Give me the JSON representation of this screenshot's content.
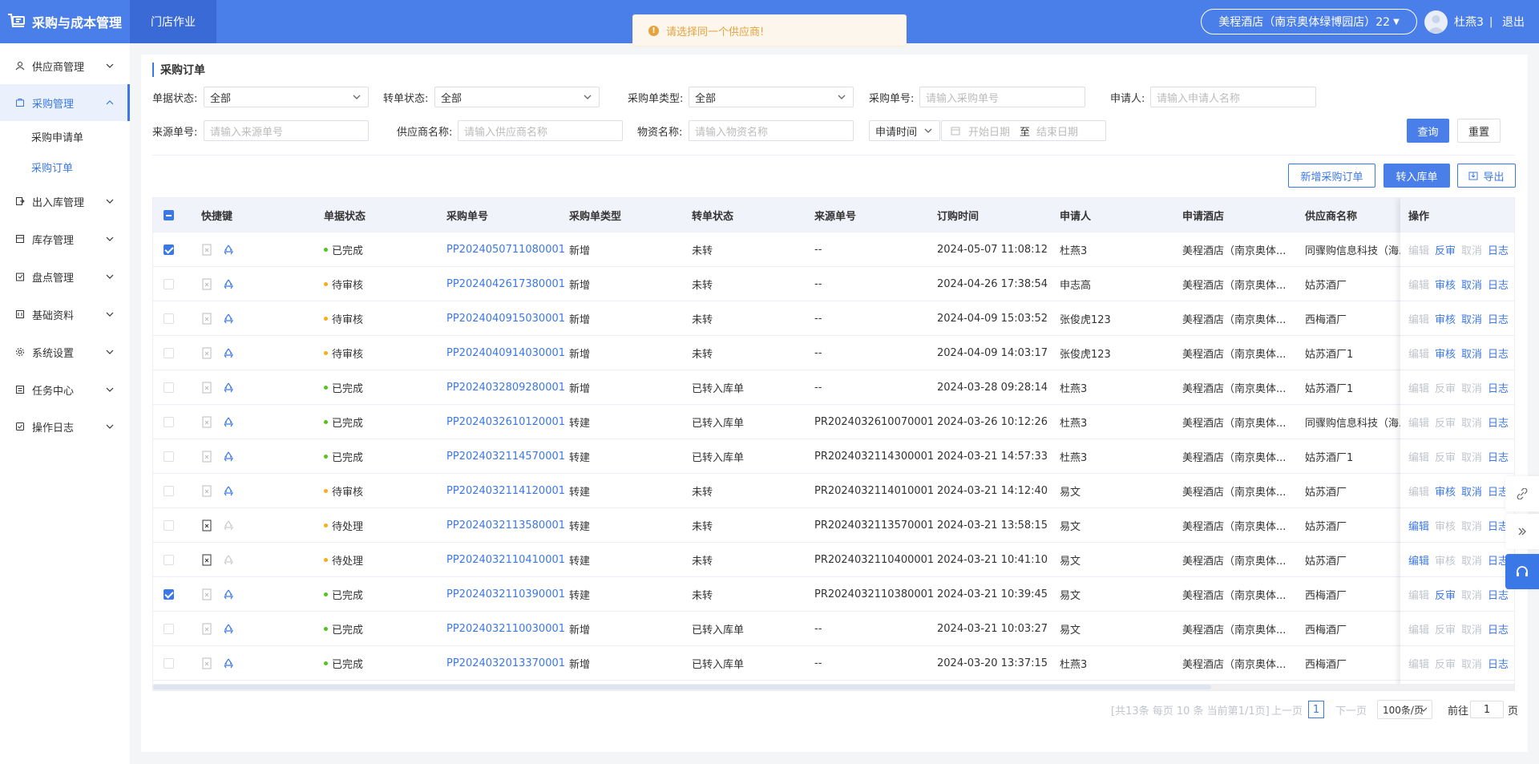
{
  "app": {
    "title": "采购与成本管理",
    "store_tab": "门店作业",
    "hotel": "美程酒店（南京奥体绿博园店）22",
    "user": "杜燕3",
    "separator": "|",
    "logout": "退出"
  },
  "toast": {
    "text": "请选择同一个供应商!"
  },
  "sidebar": {
    "items": [
      {
        "label": "供应商管理",
        "icon": "supplier-icon"
      },
      {
        "label": "采购管理",
        "icon": "purchase-icon",
        "active": true
      },
      {
        "label": "出入库管理",
        "icon": "inout-icon"
      },
      {
        "label": "库存管理",
        "icon": "stock-icon"
      },
      {
        "label": "盘点管理",
        "icon": "inventory-icon"
      },
      {
        "label": "基础资料",
        "icon": "base-data-icon"
      },
      {
        "label": "系统设置",
        "icon": "gear-icon"
      },
      {
        "label": "任务中心",
        "icon": "task-icon"
      },
      {
        "label": "操作日志",
        "icon": "log-icon"
      }
    ],
    "sub_items": [
      {
        "label": "采购申请单"
      },
      {
        "label": "采购订单",
        "current": true
      }
    ]
  },
  "page": {
    "title": "采购订单"
  },
  "filters": {
    "doc_status_label": "单据状态:",
    "doc_status_value": "全部",
    "transfer_status_label": "转单状态:",
    "transfer_status_value": "全部",
    "order_type_label": "采购单类型:",
    "order_type_value": "全部",
    "order_no_label": "采购单号:",
    "order_no_placeholder": "请输入采购单号",
    "applicant_label": "申请人:",
    "applicant_placeholder": "请输入申请人名称",
    "source_no_label": "来源单号:",
    "source_no_placeholder": "请输入来源单号",
    "supplier_label": "供应商名称:",
    "supplier_placeholder": "请输入供应商名称",
    "material_label": "物资名称:",
    "material_placeholder": "请输入物资名称",
    "time_type_value": "申请时间",
    "start_placeholder": "开始日期",
    "date_sep": "至",
    "end_placeholder": "结束日期",
    "query_label": "查询",
    "reset_label": "重置"
  },
  "toolbar": {
    "add_label": "新增采购订单",
    "to_stock_label": "转入库单",
    "export_label": "导出"
  },
  "table": {
    "headers": [
      "快捷键",
      "单据状态",
      "采购单号",
      "采购单类型",
      "转单状态",
      "来源单号",
      "订购时间",
      "申请人",
      "申请酒店",
      "供应商名称",
      "操作"
    ],
    "ops_labels": [
      "编辑",
      "反审",
      "审核",
      "取消",
      "日志"
    ],
    "status_colors": {
      "已完成": "#52c41a",
      "待审核": "#faad14",
      "待处理": "#faad14"
    },
    "rows": [
      {
        "checked": true,
        "status": "已完成",
        "no": "PP2024050711080001",
        "type": "新增",
        "transfer": "未转",
        "source": "--",
        "time": "2024-05-07 11:08:12",
        "applicant": "杜燕3",
        "hotel": "美程酒店（南京奥体...",
        "supplier": "同骤购信息科技（海...",
        "shortcut": "faded",
        "ops": [
          [
            "编辑",
            false
          ],
          [
            "反审",
            true
          ],
          [
            "取消",
            false
          ],
          [
            "日志",
            true
          ]
        ]
      },
      {
        "checked": false,
        "status": "待审核",
        "no": "PP2024042617380001",
        "type": "新增",
        "transfer": "未转",
        "source": "--",
        "time": "2024-04-26 17:38:54",
        "applicant": "申志高",
        "hotel": "美程酒店（南京奥体...",
        "supplier": "姑苏酒厂",
        "shortcut": "faded",
        "ops": [
          [
            "编辑",
            false
          ],
          [
            "审核",
            true
          ],
          [
            "取消",
            true
          ],
          [
            "日志",
            true
          ]
        ]
      },
      {
        "checked": false,
        "status": "待审核",
        "no": "PP2024040915030001",
        "type": "新增",
        "transfer": "未转",
        "source": "--",
        "time": "2024-04-09 15:03:52",
        "applicant": "张俊虎123",
        "hotel": "美程酒店（南京奥体...",
        "supplier": "西梅酒厂",
        "shortcut": "faded",
        "ops": [
          [
            "编辑",
            false
          ],
          [
            "审核",
            true
          ],
          [
            "取消",
            true
          ],
          [
            "日志",
            true
          ]
        ]
      },
      {
        "checked": false,
        "status": "待审核",
        "no": "PP2024040914030001",
        "type": "新增",
        "transfer": "未转",
        "source": "--",
        "time": "2024-04-09 14:03:17",
        "applicant": "张俊虎123",
        "hotel": "美程酒店（南京奥体...",
        "supplier": "姑苏酒厂1",
        "shortcut": "faded",
        "ops": [
          [
            "编辑",
            false
          ],
          [
            "审核",
            true
          ],
          [
            "取消",
            true
          ],
          [
            "日志",
            true
          ]
        ]
      },
      {
        "checked": false,
        "status": "已完成",
        "no": "PP2024032809280001",
        "type": "新增",
        "transfer": "已转入库单",
        "source": "--",
        "time": "2024-03-28 09:28:14",
        "applicant": "杜燕3",
        "hotel": "美程酒店（南京奥体...",
        "supplier": "姑苏酒厂1",
        "shortcut": "faded",
        "ops": [
          [
            "编辑",
            false
          ],
          [
            "反审",
            false
          ],
          [
            "取消",
            false
          ],
          [
            "日志",
            true
          ]
        ]
      },
      {
        "checked": false,
        "status": "已完成",
        "no": "PP2024032610120001",
        "type": "转建",
        "transfer": "已转入库单",
        "source": "PR2024032610070001",
        "time": "2024-03-26 10:12:26",
        "applicant": "杜燕3",
        "hotel": "美程酒店（南京奥体...",
        "supplier": "同骤购信息科技（海...",
        "shortcut": "faded",
        "ops": [
          [
            "编辑",
            false
          ],
          [
            "反审",
            false
          ],
          [
            "取消",
            false
          ],
          [
            "日志",
            true
          ]
        ]
      },
      {
        "checked": false,
        "status": "已完成",
        "no": "PP2024032114570001",
        "type": "转建",
        "transfer": "已转入库单",
        "source": "PR2024032114300001",
        "time": "2024-03-21 14:57:33",
        "applicant": "杜燕3",
        "hotel": "美程酒店（南京奥体...",
        "supplier": "姑苏酒厂1",
        "shortcut": "faded",
        "ops": [
          [
            "编辑",
            false
          ],
          [
            "反审",
            false
          ],
          [
            "取消",
            false
          ],
          [
            "日志",
            true
          ]
        ]
      },
      {
        "checked": false,
        "status": "待审核",
        "no": "PP2024032114120001",
        "type": "转建",
        "transfer": "未转",
        "source": "PR2024032114010001",
        "time": "2024-03-21 14:12:40",
        "applicant": "易文",
        "hotel": "美程酒店（南京奥体...",
        "supplier": "姑苏酒厂",
        "shortcut": "faded",
        "ops": [
          [
            "编辑",
            false
          ],
          [
            "审核",
            true
          ],
          [
            "取消",
            true
          ],
          [
            "日志",
            true
          ]
        ]
      },
      {
        "checked": false,
        "status": "待处理",
        "no": "PP2024032113580001",
        "type": "转建",
        "transfer": "未转",
        "source": "PR2024032113570001",
        "time": "2024-03-21 13:58:15",
        "applicant": "易文",
        "hotel": "美程酒店（南京奥体...",
        "supplier": "姑苏酒厂",
        "shortcut": "active",
        "ops": [
          [
            "编辑",
            true
          ],
          [
            "审核",
            false
          ],
          [
            "取消",
            false
          ],
          [
            "日志",
            true
          ]
        ]
      },
      {
        "checked": false,
        "status": "待处理",
        "no": "PP2024032110410001",
        "type": "转建",
        "transfer": "未转",
        "source": "PR2024032110400001",
        "time": "2024-03-21 10:41:10",
        "applicant": "易文",
        "hotel": "美程酒店（南京奥体...",
        "supplier": "姑苏酒厂",
        "shortcut": "active",
        "ops": [
          [
            "编辑",
            true
          ],
          [
            "审核",
            false
          ],
          [
            "取消",
            false
          ],
          [
            "日志",
            true
          ]
        ]
      },
      {
        "checked": true,
        "status": "已完成",
        "no": "PP2024032110390001",
        "type": "转建",
        "transfer": "未转",
        "source": "PR2024032110380001",
        "time": "2024-03-21 10:39:45",
        "applicant": "易文",
        "hotel": "美程酒店（南京奥体...",
        "supplier": "西梅酒厂",
        "shortcut": "faded",
        "ops": [
          [
            "编辑",
            false
          ],
          [
            "反审",
            true
          ],
          [
            "取消",
            false
          ],
          [
            "日志",
            true
          ]
        ]
      },
      {
        "checked": false,
        "status": "已完成",
        "no": "PP2024032110030001",
        "type": "新增",
        "transfer": "已转入库单",
        "source": "--",
        "time": "2024-03-21 10:03:27",
        "applicant": "易文",
        "hotel": "美程酒店（南京奥体...",
        "supplier": "西梅酒厂",
        "shortcut": "faded",
        "ops": [
          [
            "编辑",
            false
          ],
          [
            "反审",
            false
          ],
          [
            "取消",
            false
          ],
          [
            "日志",
            true
          ]
        ]
      },
      {
        "checked": false,
        "status": "已完成",
        "no": "PP2024032013370001",
        "type": "新增",
        "transfer": "已转入库单",
        "source": "--",
        "time": "2024-03-20 13:37:15",
        "applicant": "杜燕3",
        "hotel": "美程酒店（南京奥体...",
        "supplier": "西梅酒厂",
        "shortcut": "faded",
        "ops": [
          [
            "编辑",
            false
          ],
          [
            "反审",
            false
          ],
          [
            "取消",
            false
          ],
          [
            "日志",
            true
          ]
        ]
      }
    ]
  },
  "pagination": {
    "summary": "[共13条 每页 10 条 当前第1/1页]",
    "prev": "上一页",
    "current": "1",
    "next": "下一页",
    "page_size": "100条/页",
    "goto_label": "前往",
    "goto_value": "1",
    "page_unit": "页"
  },
  "colors": {
    "primary": "#4a7ee8",
    "link": "#3b78e7",
    "done": "#52c41a",
    "pending": "#faad14",
    "warning": "#e6a23c"
  }
}
